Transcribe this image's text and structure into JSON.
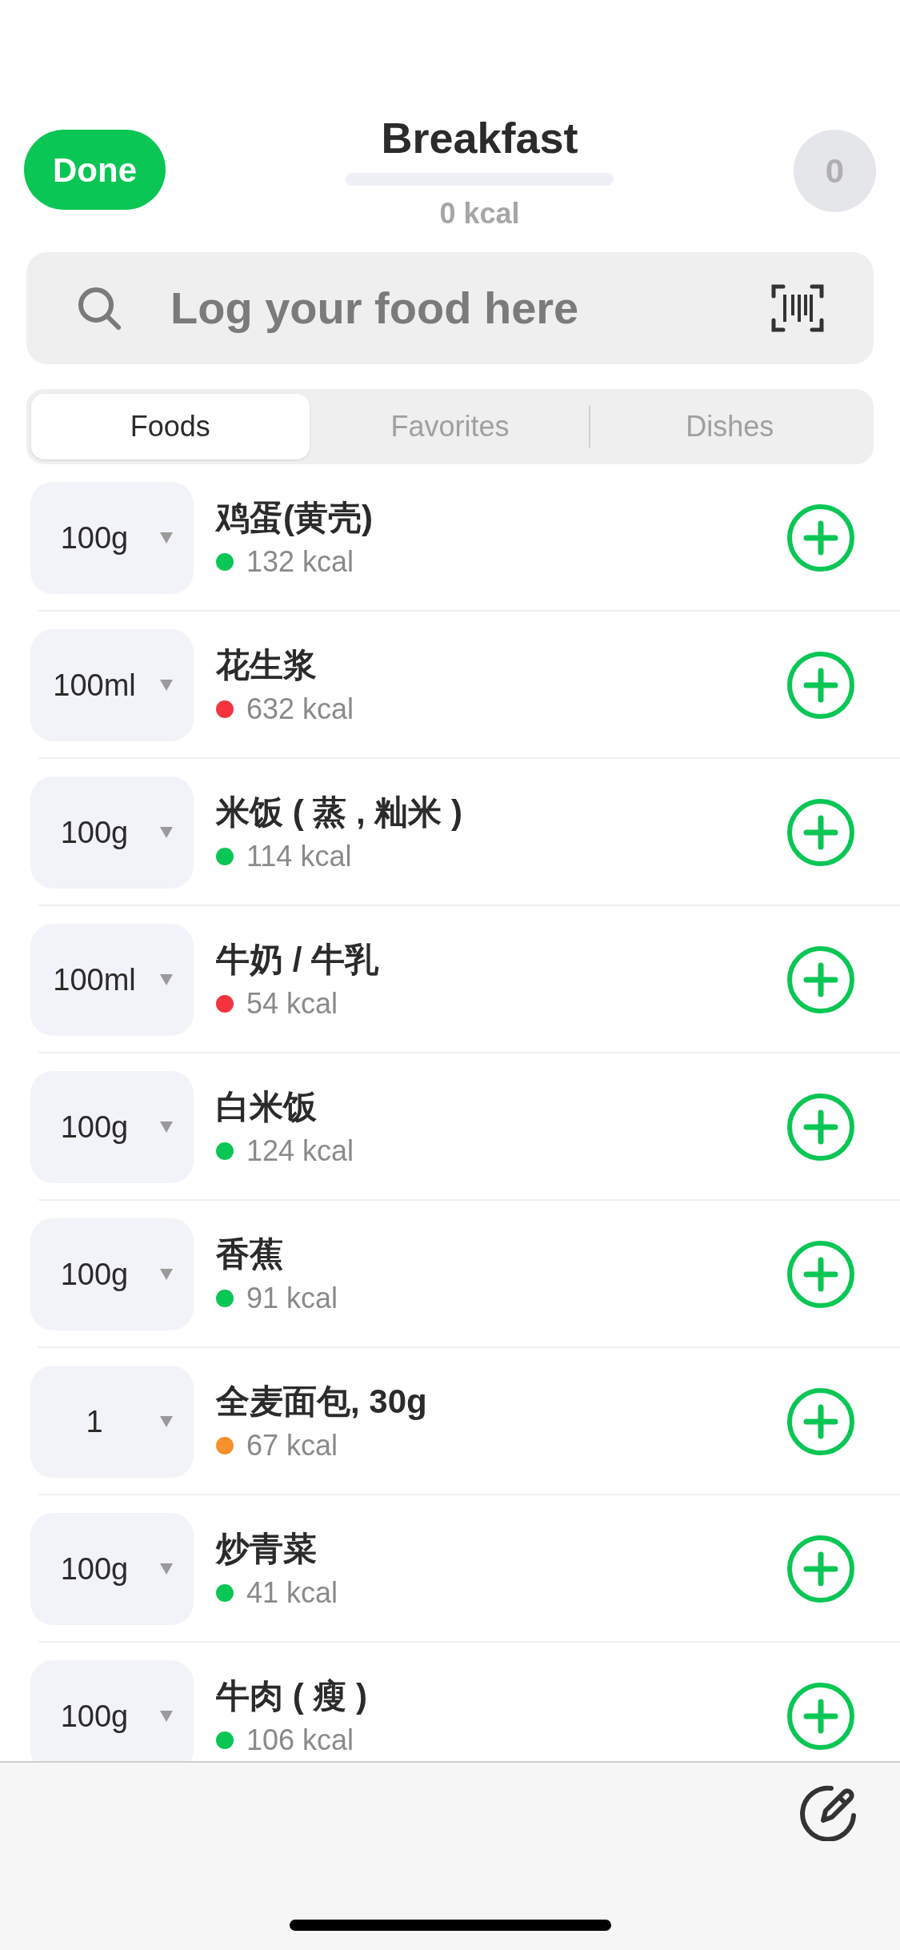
{
  "header": {
    "done_button": "Done",
    "title": "Breakfast",
    "calories": "0 kcal",
    "count_badge": "0"
  },
  "search": {
    "placeholder": "Log your food here"
  },
  "tabs": [
    {
      "label": "Foods",
      "selected": true
    },
    {
      "label": "Favorites",
      "selected": false
    },
    {
      "label": "Dishes",
      "selected": false
    }
  ],
  "foods": [
    {
      "portion": "100g",
      "name": "鸡蛋(黄壳)",
      "kcal": "132 kcal",
      "color": "#0ac655"
    },
    {
      "portion": "100ml",
      "name": "花生浆",
      "kcal": "632 kcal",
      "color": "#f5333f"
    },
    {
      "portion": "100g",
      "name": "米饭 ( 蒸 , 籼米 )",
      "kcal": "114 kcal",
      "color": "#0ac655"
    },
    {
      "portion": "100ml",
      "name": "牛奶 / 牛乳",
      "kcal": "54 kcal",
      "color": "#f5333f"
    },
    {
      "portion": "100g",
      "name": "白米饭",
      "kcal": "124 kcal",
      "color": "#0ac655"
    },
    {
      "portion": "100g",
      "name": "香蕉",
      "kcal": "91 kcal",
      "color": "#0ac655"
    },
    {
      "portion": "1",
      "name": "全麦面包, 30g",
      "kcal": "67 kcal",
      "color": "#f7902a"
    },
    {
      "portion": "100g",
      "name": "炒青菜",
      "kcal": "41 kcal",
      "color": "#0ac655"
    },
    {
      "portion": "100g",
      "name": "牛肉 ( 瘦 )",
      "kcal": "106 kcal",
      "color": "#0ac655"
    }
  ]
}
